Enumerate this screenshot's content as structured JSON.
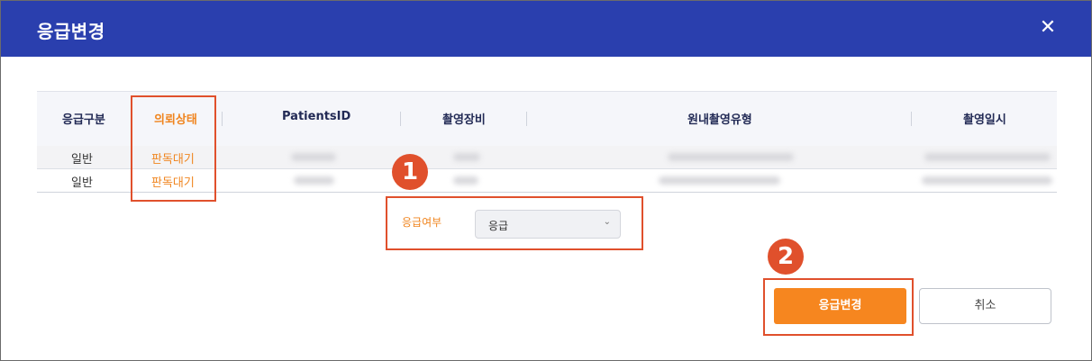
{
  "dialog": {
    "title": "응급변경",
    "close_glyph": "✕"
  },
  "table": {
    "columns": [
      "응급구분",
      "의뢰상태",
      "PatientsID",
      "촬영장비",
      "원내촬영유형",
      "촬영일시"
    ],
    "rows": [
      {
        "emergency_type": "일반",
        "request_status": "판독대기"
      },
      {
        "emergency_type": "일반",
        "request_status": "판독대기"
      }
    ]
  },
  "form": {
    "label": "응급여부",
    "select_value": "응급",
    "select_icon": "chevron-down-icon"
  },
  "buttons": {
    "confirm": "응급변경",
    "cancel": "취소"
  },
  "badges": [
    "1",
    "2"
  ],
  "colors": {
    "header_bg": "#2a3fae",
    "accent_orange": "#f6861f",
    "highlight_red": "#e0502c"
  }
}
